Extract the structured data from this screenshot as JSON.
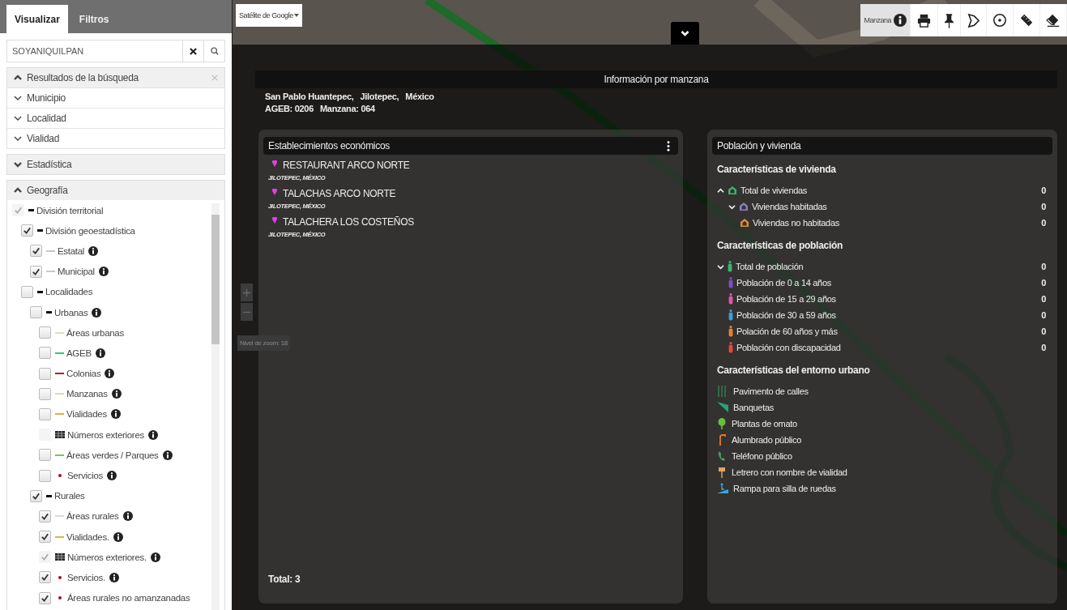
{
  "sidebar": {
    "tabs": [
      {
        "label": "Visualizar",
        "selected": true
      },
      {
        "label": "Filtros",
        "selected": false
      }
    ],
    "search": {
      "value": "SOYANIQUILPAN"
    },
    "search_results": {
      "title": "Resultados de la búsqueda",
      "expanded": true,
      "items": [
        {
          "label": "Municipio",
          "expanded": false
        },
        {
          "label": "Localidad",
          "expanded": false
        },
        {
          "label": "Vialidad",
          "expanded": false
        }
      ]
    },
    "sections": [
      {
        "title": "Estadística",
        "expanded": false
      },
      {
        "title": "Geografía",
        "expanded": true,
        "layers": [
          {
            "label": "División territorial",
            "checked": true,
            "disabled": true,
            "kind": "dash",
            "children": [
              {
                "label": "División geoestadística",
                "checked": true,
                "disabled": false,
                "kind": "dash",
                "children": [
                  {
                    "label": "Estatal",
                    "checked": true,
                    "disabled": false,
                    "kind": "line",
                    "color": "#c8c8c8",
                    "info": true
                  },
                  {
                    "label": "Municipal",
                    "checked": true,
                    "disabled": false,
                    "kind": "line",
                    "color": "#c8c8c8",
                    "info": true
                  }
                ]
              },
              {
                "label": "Localidades",
                "checked": false,
                "disabled": false,
                "kind": "dash",
                "children": [
                  {
                    "label": "Urbanas",
                    "checked": false,
                    "disabled": false,
                    "kind": "dash",
                    "info": true,
                    "children": [
                      {
                        "label": "Áreas urbanas",
                        "checked": false,
                        "disabled": false,
                        "kind": "line",
                        "color": "#e2dcc6"
                      },
                      {
                        "label": "AGEB",
                        "checked": false,
                        "disabled": false,
                        "kind": "line",
                        "color": "#2ecc71",
                        "info": true
                      },
                      {
                        "label": "Colonias",
                        "checked": false,
                        "disabled": false,
                        "kind": "line",
                        "color": "#b0202a",
                        "info": true
                      },
                      {
                        "label": "Manzanas",
                        "checked": false,
                        "disabled": false,
                        "kind": "line",
                        "color": "#e6d6b0",
                        "info": true
                      },
                      {
                        "label": "Vialidades",
                        "checked": false,
                        "disabled": false,
                        "kind": "line",
                        "color": "#e0b040",
                        "info": true
                      },
                      {
                        "label": "Números exteriores",
                        "checked": false,
                        "disabled": true,
                        "kind": "grid",
                        "info": true
                      },
                      {
                        "label": "Áreas verdes / Parques",
                        "checked": false,
                        "disabled": false,
                        "kind": "line",
                        "color": "#7ac943",
                        "info": true
                      },
                      {
                        "label": "Servicios",
                        "checked": false,
                        "disabled": false,
                        "kind": "dot",
                        "color": "#a01020",
                        "info": true
                      }
                    ]
                  },
                  {
                    "label": "Rurales",
                    "checked": true,
                    "disabled": false,
                    "kind": "dash",
                    "children": [
                      {
                        "label": "Áreas rurales",
                        "checked": true,
                        "disabled": false,
                        "kind": "line",
                        "color": "#dcdcdc",
                        "info": true
                      },
                      {
                        "label": "Vialidades.",
                        "checked": true,
                        "disabled": false,
                        "kind": "line",
                        "color": "#e0b040",
                        "info": true
                      },
                      {
                        "label": "Números exteriores.",
                        "checked": true,
                        "disabled": true,
                        "kind": "grid",
                        "info": true
                      },
                      {
                        "label": "Servicios.",
                        "checked": true,
                        "disabled": false,
                        "kind": "dot",
                        "color": "#a01020",
                        "info": true
                      },
                      {
                        "label": "Áreas rurales no amanzanadas",
                        "checked": true,
                        "disabled": false,
                        "kind": "dot",
                        "color": "#a01020"
                      }
                    ]
                  }
                ]
              }
            ]
          }
        ]
      }
    ]
  },
  "map": {
    "base_layer": "Satélite de Google",
    "zoom_level": "Nivel de zoom: 18",
    "tools": [
      {
        "kind": "info",
        "label": "Manzana",
        "selected": true
      },
      {
        "kind": "print",
        "selected": false
      },
      {
        "kind": "pin",
        "selected": false
      },
      {
        "kind": "polygon",
        "selected": false
      },
      {
        "kind": "circle",
        "selected": false
      },
      {
        "kind": "ruler",
        "selected": false
      },
      {
        "kind": "eraser",
        "selected": false
      }
    ]
  },
  "info_panel": {
    "title": "Información por manzana",
    "place": [
      "San Pablo Huantepec,",
      "Jilotepec,",
      "México"
    ],
    "ids": [
      "AGEB: 0206",
      "Manzana: 064"
    ],
    "establishments": {
      "title": "Establecimientos económicos",
      "items": [
        {
          "name": "RESTAURANT ARCO NORTE",
          "place": "JILOTEPEC, MÉXICO"
        },
        {
          "name": "TALACHAS ARCO NORTE",
          "place": "JILOTEPEC, MÉXICO"
        },
        {
          "name": "TALACHERA LOS COSTEÑOS",
          "place": "JILOTEPEC, MÉXICO"
        }
      ],
      "total": "Total: 3"
    },
    "population": {
      "title": "Población y vivienda",
      "groups": [
        {
          "title": "Características de vivienda",
          "rows": [
            {
              "label": "Total de viviendas",
              "value": "0",
              "kind": "house",
              "color": "#3cb371",
              "expanded": true,
              "children": [
                {
                  "label": "Viviendas habitadas",
                  "value": "0",
                  "kind": "house",
                  "color": "#8a7fc0",
                  "expanded": false,
                  "children": [
                    {
                      "label": "Viviendas no habitadas",
                      "value": "0",
                      "kind": "house",
                      "color": "#e08a3a"
                    }
                  ]
                }
              ]
            }
          ]
        },
        {
          "title": "Características de población",
          "rows": [
            {
              "label": "Total de población",
              "value": "0",
              "kind": "person",
              "color": "#3cb371",
              "expanded": false,
              "children": [
                {
                  "label": "Población de 0 a 14 años",
                  "value": "0",
                  "kind": "person",
                  "color": "#7b4fc9"
                },
                {
                  "label": "Población de 15 a 29 años",
                  "value": "0",
                  "kind": "person",
                  "color": "#e055b0"
                },
                {
                  "label": "Población de 30 a 59 años",
                  "value": "0",
                  "kind": "person",
                  "color": "#3aa0d8"
                },
                {
                  "label": "Polación de 60 años y más",
                  "value": "0",
                  "kind": "person",
                  "color": "#e8832a"
                },
                {
                  "label": "Población con discapacidad",
                  "value": "0",
                  "kind": "person",
                  "color": "#e04a3a"
                }
              ]
            }
          ]
        }
      ],
      "urban": {
        "title": "Características del entorno urbano",
        "items": [
          {
            "kind": "pavement",
            "label": "Pavimento de calles"
          },
          {
            "kind": "sidewalk",
            "label": "Banquetas"
          },
          {
            "kind": "tree",
            "label": "Plantas de omato"
          },
          {
            "kind": "streetlight",
            "label": "Alumbrado público"
          },
          {
            "kind": "phone",
            "label": "Teléfono público"
          },
          {
            "kind": "sign",
            "label": "Letrero con nombre de vialidad"
          },
          {
            "kind": "ramp",
            "label": "Rampa para silla de ruedas"
          }
        ]
      }
    }
  }
}
